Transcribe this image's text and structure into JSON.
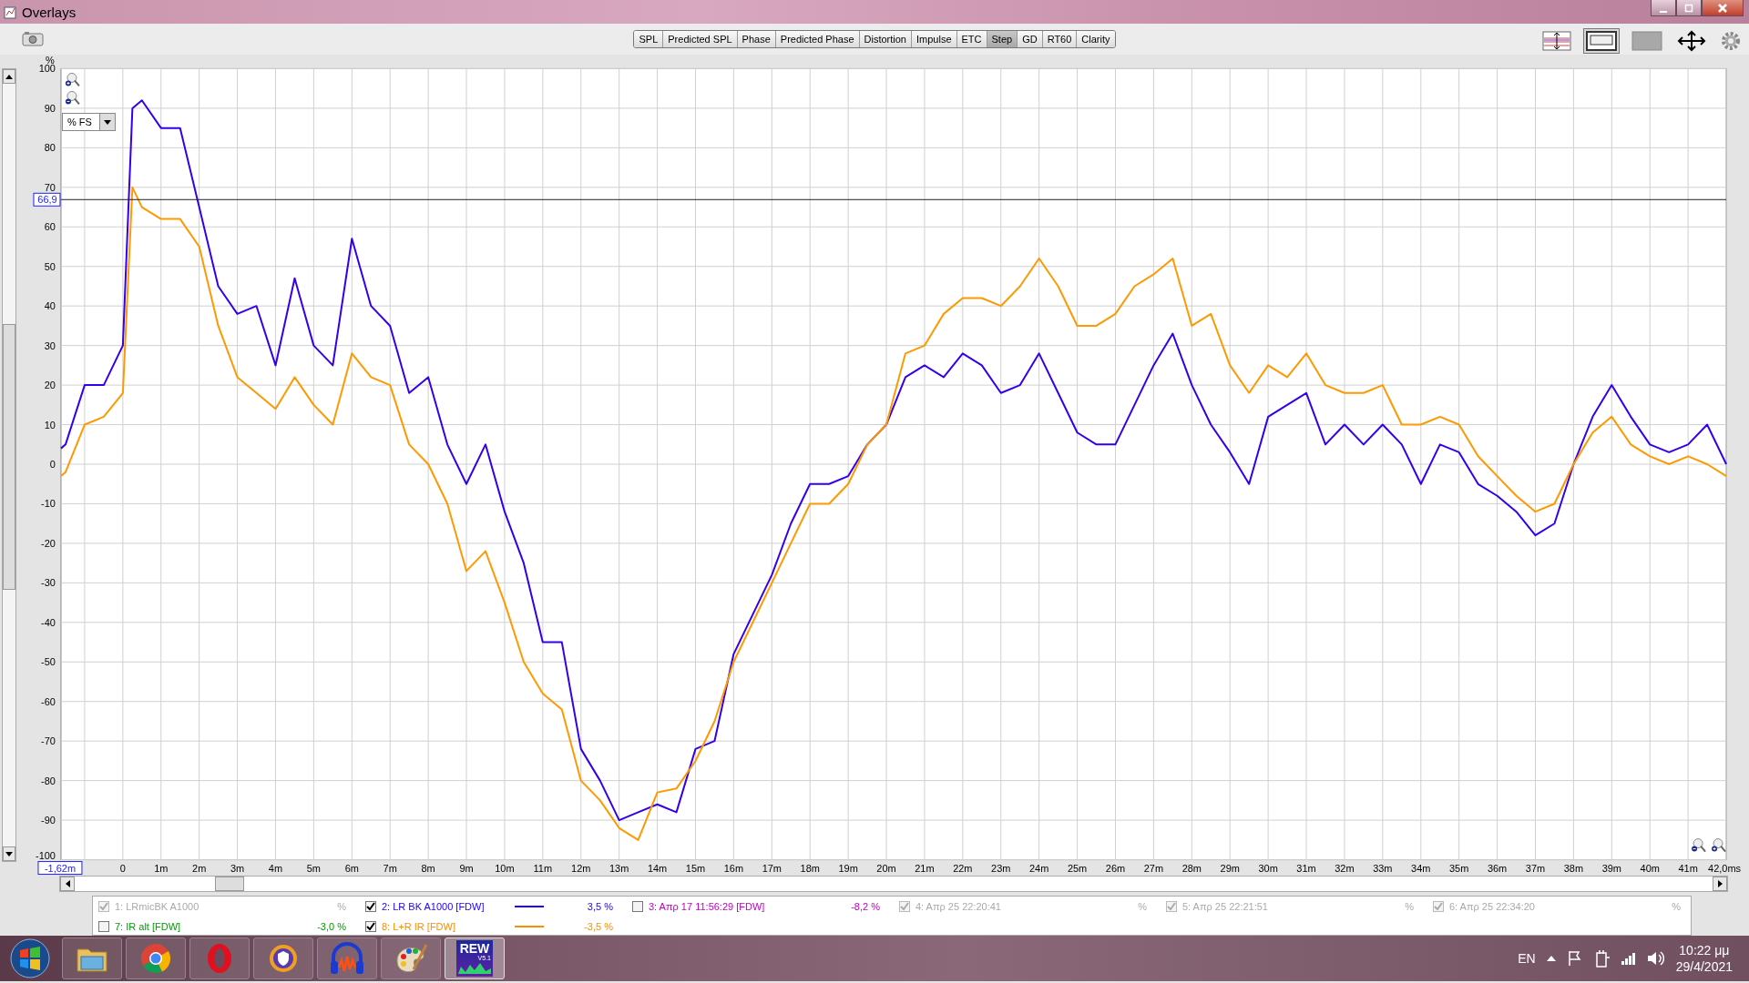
{
  "window": {
    "title": "Overlays"
  },
  "tabs": [
    {
      "label": "SPL",
      "selected": false
    },
    {
      "label": "Predicted SPL",
      "selected": false
    },
    {
      "label": "Phase",
      "selected": false
    },
    {
      "label": "Predicted Phase",
      "selected": false
    },
    {
      "label": "Distortion",
      "selected": false
    },
    {
      "label": "Impulse",
      "selected": false
    },
    {
      "label": "ETC",
      "selected": false
    },
    {
      "label": "Step",
      "selected": true
    },
    {
      "label": "GD",
      "selected": false
    },
    {
      "label": "RT60",
      "selected": false
    },
    {
      "label": "Clarity",
      "selected": false
    }
  ],
  "scale_dropdown": {
    "value": "% FS"
  },
  "chart": {
    "chart_data": {
      "type": "line",
      "ylabel": "%",
      "xlim": [
        -1.62,
        42
      ],
      "ylim": [
        -100,
        100
      ],
      "yticks": [
        -100,
        -90,
        -80,
        -70,
        -60,
        -50,
        -40,
        -30,
        -20,
        -10,
        0,
        10,
        20,
        30,
        40,
        50,
        60,
        70,
        80,
        90,
        100
      ],
      "xticks": [
        {
          "value": -1.62,
          "label": "-1,62m"
        },
        {
          "value": 0,
          "label": "0"
        },
        {
          "value": 1,
          "label": "1m"
        },
        {
          "value": 2,
          "label": "2m"
        },
        {
          "value": 3,
          "label": "3m"
        },
        {
          "value": 4,
          "label": "4m"
        },
        {
          "value": 5,
          "label": "5m"
        },
        {
          "value": 6,
          "label": "6m"
        },
        {
          "value": 7,
          "label": "7m"
        },
        {
          "value": 8,
          "label": "8m"
        },
        {
          "value": 9,
          "label": "9m"
        },
        {
          "value": 10,
          "label": "10m"
        },
        {
          "value": 11,
          "label": "11m"
        },
        {
          "value": 12,
          "label": "12m"
        },
        {
          "value": 13,
          "label": "13m"
        },
        {
          "value": 14,
          "label": "14m"
        },
        {
          "value": 15,
          "label": "15m"
        },
        {
          "value": 16,
          "label": "16m"
        },
        {
          "value": 17,
          "label": "17m"
        },
        {
          "value": 18,
          "label": "18m"
        },
        {
          "value": 19,
          "label": "19m"
        },
        {
          "value": 20,
          "label": "20m"
        },
        {
          "value": 21,
          "label": "21m"
        },
        {
          "value": 22,
          "label": "22m"
        },
        {
          "value": 23,
          "label": "23m"
        },
        {
          "value": 24,
          "label": "24m"
        },
        {
          "value": 25,
          "label": "25m"
        },
        {
          "value": 26,
          "label": "26m"
        },
        {
          "value": 27,
          "label": "27m"
        },
        {
          "value": 28,
          "label": "28m"
        },
        {
          "value": 29,
          "label": "29m"
        },
        {
          "value": 30,
          "label": "30m"
        },
        {
          "value": 31,
          "label": "31m"
        },
        {
          "value": 32,
          "label": "32m"
        },
        {
          "value": 33,
          "label": "33m"
        },
        {
          "value": 34,
          "label": "34m"
        },
        {
          "value": 35,
          "label": "35m"
        },
        {
          "value": 36,
          "label": "36m"
        },
        {
          "value": 37,
          "label": "37m"
        },
        {
          "value": 38,
          "label": "38m"
        },
        {
          "value": 39,
          "label": "39m"
        },
        {
          "value": 40,
          "label": "40m"
        },
        {
          "value": 41,
          "label": "41m"
        },
        {
          "value": 42,
          "label": "42,0ms"
        }
      ],
      "x": [
        -1.62,
        -1.5,
        -1,
        -0.5,
        0,
        0.25,
        0.5,
        1,
        1.5,
        2,
        2.5,
        3,
        3.5,
        4,
        4.5,
        5,
        5.5,
        6,
        6.5,
        7,
        7.5,
        8,
        8.5,
        9,
        9.5,
        10,
        10.5,
        11,
        11.5,
        12,
        12.5,
        13,
        13.5,
        14,
        14.5,
        15,
        15.5,
        16,
        16.5,
        17,
        17.5,
        18,
        18.5,
        19,
        19.5,
        20,
        20.5,
        21,
        21.5,
        22,
        22.5,
        23,
        23.5,
        24,
        24.5,
        25,
        25.5,
        26,
        26.5,
        27,
        27.5,
        28,
        28.5,
        29,
        29.5,
        30,
        30.5,
        31,
        31.5,
        32,
        32.5,
        33,
        33.5,
        34,
        34.5,
        35,
        35.5,
        36,
        36.5,
        37,
        37.5,
        38,
        38.5,
        39,
        39.5,
        40,
        40.5,
        41,
        41.5,
        42
      ],
      "series": [
        {
          "color": "#3300ee",
          "values": [
            4,
            5,
            20,
            20,
            30,
            90,
            92,
            85,
            85,
            65,
            45,
            38,
            40,
            25,
            47,
            30,
            25,
            57,
            40,
            35,
            18,
            22,
            5,
            -5,
            5,
            -12,
            -25,
            -45,
            -45,
            -72,
            -80,
            -90,
            -88,
            -86,
            -88,
            -72,
            -70,
            -48,
            -38,
            -28,
            -15,
            -5,
            -5,
            -3,
            5,
            10,
            22,
            25,
            22,
            28,
            25,
            18,
            20,
            28,
            18,
            8,
            5,
            5,
            15,
            25,
            33,
            20,
            10,
            3,
            -5,
            12,
            15,
            18,
            5,
            10,
            5,
            10,
            5,
            -5,
            5,
            3,
            -5,
            -8,
            -12,
            -18,
            -15,
            0,
            12,
            20,
            12,
            5,
            3,
            5,
            10,
            0
          ]
        },
        {
          "color": "#ff9900",
          "values": [
            -3,
            -2,
            10,
            12,
            18,
            70,
            65,
            62,
            62,
            55,
            35,
            22,
            18,
            14,
            22,
            15,
            10,
            28,
            22,
            20,
            5,
            0,
            -10,
            -27,
            -22,
            -35,
            -50,
            -58,
            -62,
            -80,
            -85,
            -92,
            -95,
            -83,
            -82,
            -75,
            -65,
            -50,
            -40,
            -30,
            -20,
            -10,
            -10,
            -5,
            5,
            10,
            28,
            30,
            38,
            42,
            42,
            40,
            45,
            52,
            45,
            35,
            35,
            38,
            45,
            48,
            52,
            35,
            38,
            25,
            18,
            25,
            22,
            28,
            20,
            18,
            18,
            20,
            10,
            10,
            12,
            10,
            2,
            -3,
            -8,
            -12,
            -10,
            0,
            8,
            12,
            5,
            2,
            0,
            2,
            0,
            -3
          ]
        }
      ],
      "grid": true,
      "ref_lines": [
        {
          "axis": "y",
          "value": 66.9,
          "label": "66,9"
        }
      ]
    }
  },
  "legend": [
    {
      "label": "1: LRmicBK A1000",
      "checked": true,
      "disabled": true,
      "value": "%"
    },
    {
      "label": "2: LR BK A1000 [FDW]",
      "checked": true,
      "disabled": false,
      "color": "#2200ff",
      "value": "3,5 %"
    },
    {
      "label": "3: Απρ 17 11:56:29 [FDW]",
      "checked": false,
      "disabled": false,
      "color": "#c000c0",
      "value": "-8,2 %"
    },
    {
      "label": "4: Απρ 25 22:20:41",
      "checked": true,
      "disabled": true,
      "value": "%"
    },
    {
      "label": "5: Απρ 25 22:21:51",
      "checked": true,
      "disabled": true,
      "value": "%"
    },
    {
      "label": "6: Απρ 25 22:34:20",
      "checked": true,
      "disabled": true,
      "value": "%"
    },
    {
      "label": "7: IR alt [FDW]",
      "checked": false,
      "disabled": false,
      "color": "#00a000",
      "value": "-3,0 %"
    },
    {
      "label": "8: L+R IR [FDW]",
      "checked": true,
      "disabled": false,
      "color": "#ff8c00",
      "value": "-3,5 %"
    }
  ],
  "taskbar": {
    "apps": [
      {
        "kind": "folder"
      },
      {
        "kind": "chrome"
      },
      {
        "kind": "ring"
      },
      {
        "kind": "shield"
      },
      {
        "kind": "headphones"
      },
      {
        "kind": "palette"
      },
      {
        "kind": "rew",
        "title": "REW",
        "version": "V5.1",
        "selected": true
      }
    ],
    "language": "EN",
    "time": "10:22 μμ",
    "date": "29/4/2021"
  }
}
